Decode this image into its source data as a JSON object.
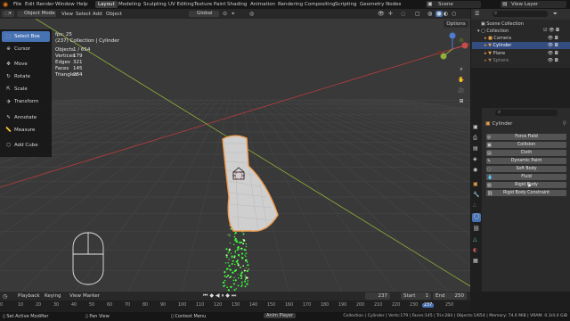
{
  "topbar": {
    "menus": [
      "File",
      "Edit",
      "Render",
      "Window",
      "Help"
    ],
    "workspaces": [
      "Layout",
      "Modeling",
      "Sculpting",
      "UV Editing",
      "Texture Paint",
      "Shading",
      "Animation",
      "Rendering",
      "Compositing",
      "Scripting",
      "Geometry Nodes"
    ],
    "active_workspace": "Layout",
    "scene": "Scene",
    "view_layer": "View Layer"
  },
  "viewport_header": {
    "mode": "Object Mode",
    "menus": [
      "View",
      "Select",
      "Add",
      "Object"
    ],
    "transform_orientation": "Global",
    "options": "Options"
  },
  "toolbar": {
    "tools": [
      {
        "label": "Select Box",
        "icon": "select-box-icon",
        "active": true
      },
      {
        "label": "Cursor",
        "icon": "cursor-icon",
        "active": false
      },
      {
        "label": "Move",
        "icon": "move-icon",
        "active": false
      },
      {
        "label": "Rotate",
        "icon": "rotate-icon",
        "active": false
      },
      {
        "label": "Scale",
        "icon": "scale-icon",
        "active": false
      },
      {
        "label": "Transform",
        "icon": "transform-icon",
        "active": false
      },
      {
        "label": "Annotate",
        "icon": "annotate-icon",
        "active": false
      },
      {
        "label": "Measure",
        "icon": "measure-icon",
        "active": false
      },
      {
        "label": "Add Cube",
        "icon": "add-cube-icon",
        "active": false
      }
    ]
  },
  "stats": {
    "fps": "fps: 25",
    "collection": "(237) Collection | Cylinder",
    "rows": [
      {
        "label": "Objects",
        "value": "1 / 654"
      },
      {
        "label": "Vertices",
        "value": "179"
      },
      {
        "label": "Edges",
        "value": "321"
      },
      {
        "label": "Faces",
        "value": "145"
      },
      {
        "label": "Triangles",
        "value": "284"
      }
    ]
  },
  "outliner": {
    "title": "Scene Collection",
    "items": [
      {
        "label": "Collection",
        "selected": false,
        "indent": 1
      },
      {
        "label": "Camera",
        "selected": false,
        "indent": 2
      },
      {
        "label": "Cylinder",
        "selected": true,
        "indent": 2
      },
      {
        "label": "Plane",
        "selected": false,
        "indent": 2
      },
      {
        "label": "Sphere",
        "selected": false,
        "indent": 2
      }
    ]
  },
  "properties": {
    "object_name": "Cylinder",
    "physics_buttons": [
      "Force Field",
      "Collision",
      "Cloth",
      "Dynamic Paint",
      "Soft Body",
      "Fluid",
      "Rigid Body",
      "Rigid Body Constraint"
    ]
  },
  "timeline": {
    "menus": [
      "Playback",
      "Keying",
      "View",
      "Marker"
    ],
    "current_frame": "237",
    "start_label": "Start",
    "start": "1",
    "end_label": "End",
    "end": "250",
    "ticks": [
      "0",
      "10",
      "20",
      "30",
      "40",
      "50",
      "60",
      "70",
      "80",
      "90",
      "100",
      "110",
      "120",
      "130",
      "140",
      "150",
      "160",
      "170",
      "180",
      "190",
      "200",
      "210",
      "220",
      "230",
      "237",
      "250",
      "260"
    ]
  },
  "statusbar": {
    "left": "Set Active Modifier",
    "pan": "Pan View",
    "context": "Context Menu",
    "anim": "Anim Player",
    "info": "Collection | Cylinder | Verts:179 | Faces:145 | Tris:284 | Objects:1/654 | Memory: 74.6 MiB | VRAM: 0.3/4.0 GiB"
  },
  "colors": {
    "accent": "#4772b3",
    "selection": "#f29d4d",
    "particles": "#3cff3c",
    "x_axis": "#bb3c3c",
    "y_axis": "#8fb03a"
  }
}
